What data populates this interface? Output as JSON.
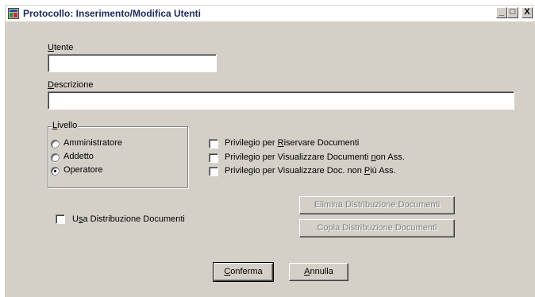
{
  "window": {
    "title": "Protocollo: Inserimento/Modifica Utenti",
    "minimize": "_",
    "maximize": "□",
    "close": "X"
  },
  "form": {
    "utente_label_u": "U",
    "utente_label_rest": "tente",
    "utente_value": "",
    "descrizione_label_u": "D",
    "descrizione_label_rest": "escrizione",
    "descrizione_value": ""
  },
  "livello": {
    "legend_u": "L",
    "legend_rest": "ivello",
    "options": [
      {
        "label": "Amministratore",
        "checked": false
      },
      {
        "label": "Addetto",
        "checked": false
      },
      {
        "label": "Operatore",
        "checked": true
      }
    ]
  },
  "privileges": [
    {
      "pre": "Privilegio per ",
      "u": "R",
      "post": "iservare Documenti",
      "checked": false
    },
    {
      "pre": "Privilegio per Visualizzare Documenti ",
      "u": "n",
      "post": "on Ass.",
      "checked": false
    },
    {
      "pre": "Privilegio per Visualizzare Doc. non ",
      "u": "P",
      "post": "iù Ass.",
      "checked": false
    }
  ],
  "distribuzione": {
    "use_pre": "U",
    "use_u": "s",
    "use_post": "a Distribuzione Documenti",
    "use_checked": false,
    "elimina_label": "Elimina Distribuzione Documenti",
    "copia_label": "Copia Distribuzione Documenti"
  },
  "buttons": {
    "conferma_u": "C",
    "conferma_rest": "onferma",
    "annulla_u": "A",
    "annulla_rest": "nnulla"
  },
  "icons": {
    "app": "app-window-icon"
  }
}
